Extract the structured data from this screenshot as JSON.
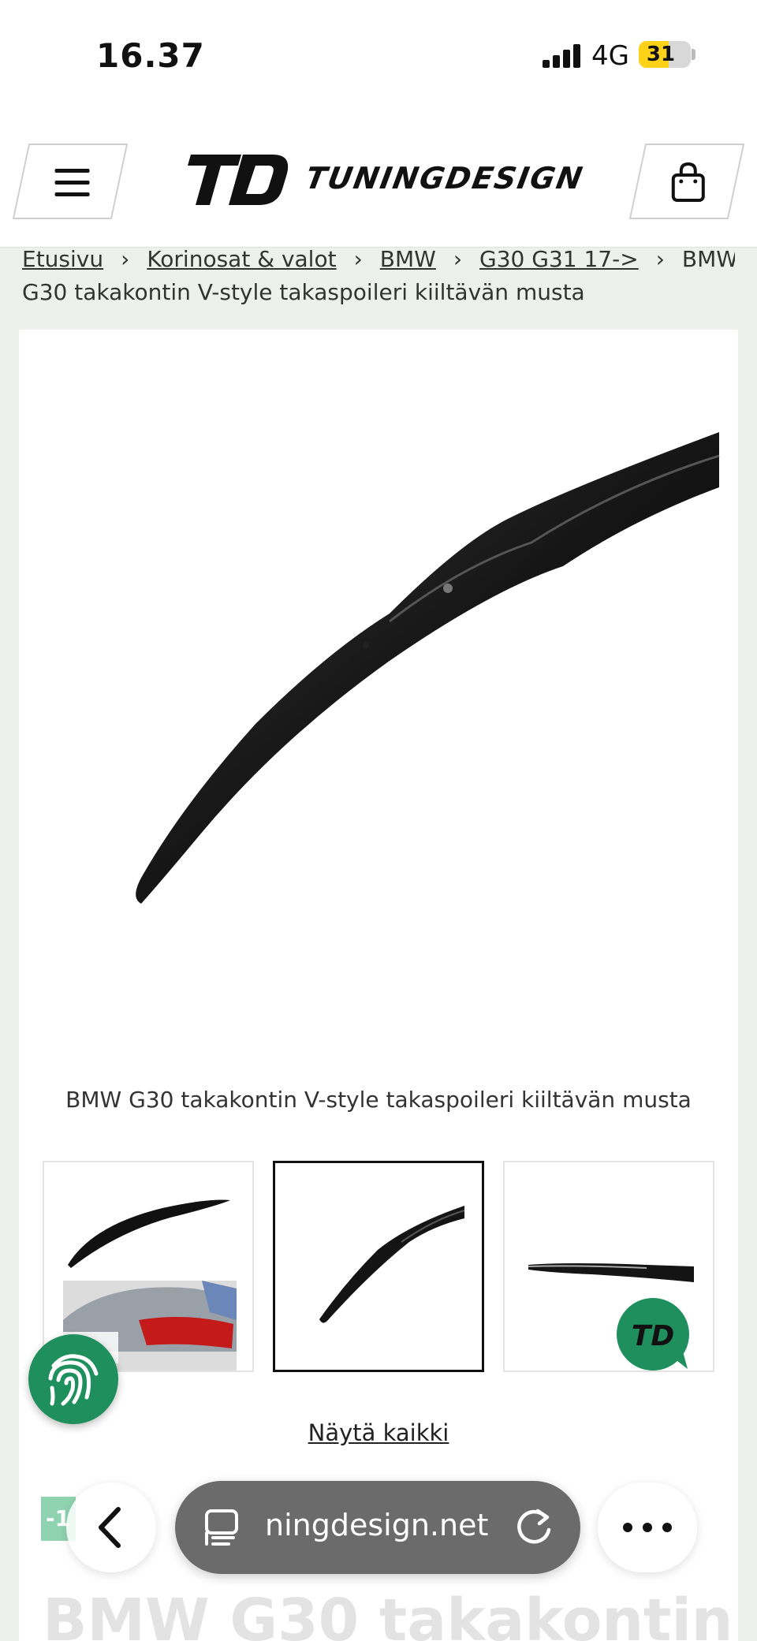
{
  "status_bar": {
    "time": "16.37",
    "network": "4G",
    "battery": "31",
    "battery_level": 0.31
  },
  "header": {
    "logo_mark": "TD",
    "logo_text": "TUNINGDESIGN",
    "menu_icon": "hamburger-menu-icon",
    "cart_icon": "shopping-bag-icon"
  },
  "breadcrumb": {
    "items": [
      "Etusivu",
      "Korinosat & valot",
      "BMW",
      "G30 G31 17->"
    ],
    "current": "BMW G30 takakontin V-style takaspoileri kiiltävän musta",
    "current_line1": "BMW",
    "current_line2": "G30 takakontin V-style takaspoileri kiiltävän musta",
    "separator": "›"
  },
  "product": {
    "image_caption": "BMW G30 takakontin V-style takaspoileri kiiltävän musta",
    "show_all": "Näytä kaikki",
    "sale_badge": "-1",
    "title_peek": "BMW G30 takakontin",
    "thumbnails": [
      "spoiler-on-car",
      "spoiler-top-view",
      "spoiler-side-view-td-logo"
    ]
  },
  "browser": {
    "url": "ningdesign.net",
    "back_icon": "chevron-left-icon",
    "tabs_icon": "page-tabs-icon",
    "reload_icon": "reload-icon",
    "more_icon": "more-dots-icon"
  },
  "colors": {
    "brand_green": "#1f8f5e",
    "battery_yellow": "#ffd21a"
  }
}
